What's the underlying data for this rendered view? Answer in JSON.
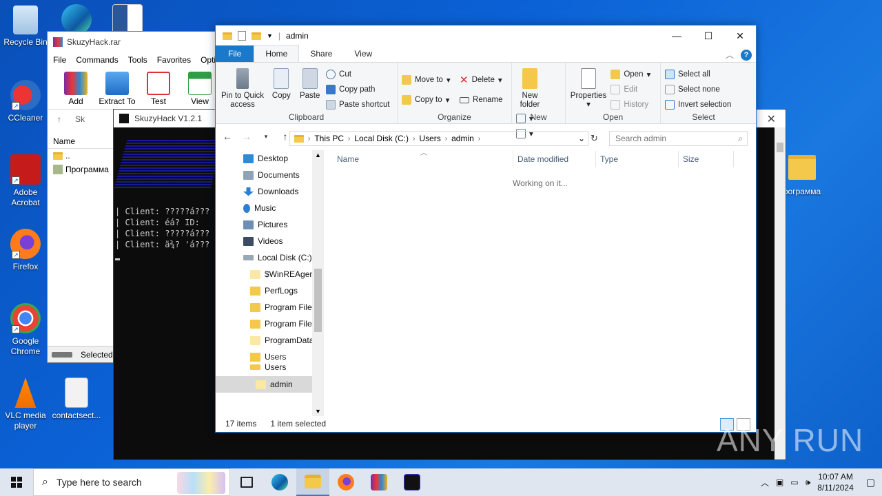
{
  "desktop": {
    "icons": [
      {
        "label": "Recycle Bin"
      },
      {
        "label": "CCleaner"
      },
      {
        "label": "Adobe Acrobat"
      },
      {
        "label": "Firefox"
      },
      {
        "label": "Google Chrome"
      },
      {
        "label": "VLC media player"
      },
      {
        "label": "contactsect..."
      }
    ],
    "right_folder_label": "рограмма"
  },
  "winrar": {
    "title": "SkuzyHack.rar",
    "menu": [
      "File",
      "Commands",
      "Tools",
      "Favorites",
      "Optio"
    ],
    "tools": [
      "Add",
      "Extract To",
      "Test",
      "View"
    ],
    "addr_fragment": "Sk",
    "list_header": "Name",
    "rows": [
      "..",
      "Программа"
    ],
    "status": "Selected"
  },
  "console": {
    "title": "SkuzyHack V1.2.1",
    "lines": [
      "| Client: ?????á???",
      "| Client: éá? ID:",
      "| Client: ?????á???",
      "| Client: ä¾? 'á???"
    ]
  },
  "explorer": {
    "title": "admin",
    "tabs": {
      "file": "File",
      "home": "Home",
      "share": "Share",
      "view": "View"
    },
    "clipboard": {
      "pin": "Pin to Quick access",
      "copy": "Copy",
      "paste": "Paste",
      "cut": "Cut",
      "copy_path": "Copy path",
      "paste_shortcut": "Paste shortcut",
      "group": "Clipboard"
    },
    "organize": {
      "move_to": "Move to",
      "copy_to": "Copy to",
      "delete": "Delete",
      "rename": "Rename",
      "group": "Organize"
    },
    "new": {
      "new_folder": "New folder",
      "group": "New"
    },
    "open": {
      "properties": "Properties",
      "open": "Open",
      "edit": "Edit",
      "history": "History",
      "group": "Open"
    },
    "select": {
      "select_all": "Select all",
      "select_none": "Select none",
      "invert": "Invert selection",
      "group": "Select"
    },
    "breadcrumb": [
      "This PC",
      "Local Disk (C:)",
      "Users",
      "admin"
    ],
    "search_placeholder": "Search admin",
    "nav_items": [
      "Desktop",
      "Documents",
      "Downloads",
      "Music",
      "Pictures",
      "Videos",
      "Local Disk (C:)",
      "$WinREAgent",
      "PerfLogs",
      "Program Files",
      "Program Files",
      "ProgramData",
      "Users",
      "Users",
      "admin"
    ],
    "columns": [
      "Name",
      "Date modified",
      "Type",
      "Size"
    ],
    "working": "Working on it...",
    "status_items": "17 items",
    "status_selected": "1 item selected"
  },
  "watermark": "ANY RUN",
  "taskbar": {
    "search_placeholder": "Type here to search",
    "time": "10:07 AM",
    "date": "8/11/2024"
  }
}
